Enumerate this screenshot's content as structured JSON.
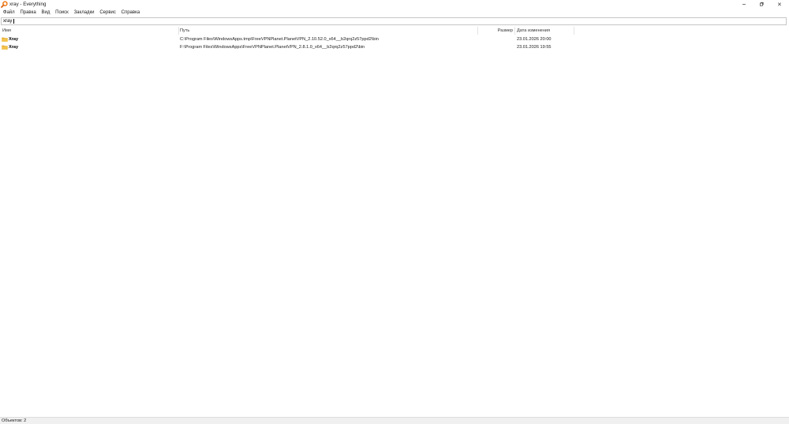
{
  "window": {
    "title": "xray - Everything",
    "app_icon": "everything-magnifier-icon",
    "controls": [
      "minimize-icon",
      "restore-icon",
      "close-icon"
    ]
  },
  "menu": {
    "items": [
      "Файл",
      "Правка",
      "Вид",
      "Поиск",
      "Закладки",
      "Сервис",
      "Справка"
    ]
  },
  "search": {
    "value": "xray"
  },
  "results": {
    "columns": {
      "name": "Имя",
      "path": "Путь",
      "size": "Размер",
      "modified": "Дата изменения"
    },
    "rows": [
      {
        "icon": "folder-icon",
        "name": "Xray",
        "path": "C:\\Program Files\\WindowsApps.tmp\\FreeVPNPlanet.PlanetVPN_2.10.52.0_x64__b2qrq2z57ppd2\\bin",
        "modified": "23.01.2026 20:00"
      },
      {
        "icon": "folder-icon",
        "name": "Xray",
        "path": "F:\\Program Files\\WindowsApps\\FreeVPNPlanet.PlanetVPN_2.8.1.0_x64__b2qrq2z57ppd2\\bin",
        "modified": "23.01.2026 19:55"
      }
    ]
  },
  "status_bar": {
    "text": "Объектов: 2"
  },
  "colors": {
    "app_icon": "#f07a1a",
    "folder": "#f3c24b",
    "folder_dark": "#dfa52c",
    "status_bar_bg": "#f0f0f0"
  }
}
